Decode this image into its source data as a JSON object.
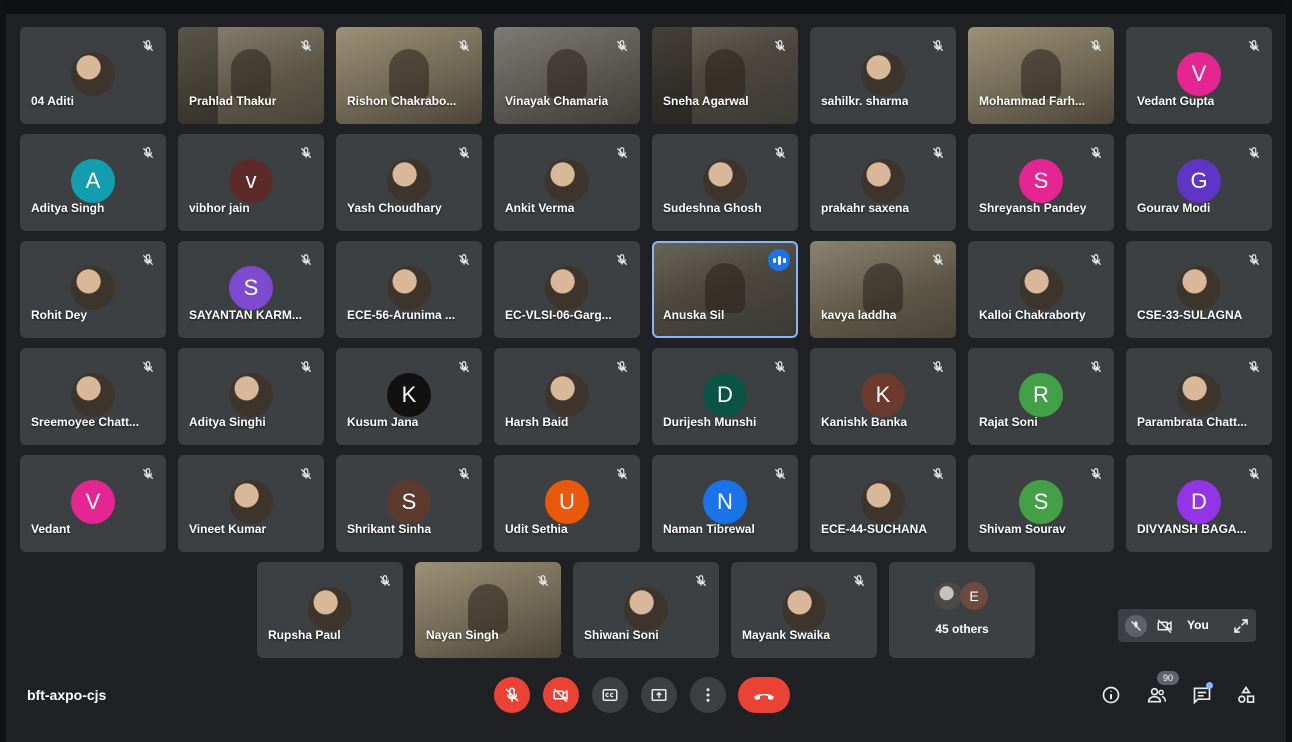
{
  "meeting": {
    "code": "bft-axpo-cjs"
  },
  "participants": [
    {
      "name": "04 Aditi",
      "type": "photo"
    },
    {
      "name": "Prahlad Thakur",
      "type": "video"
    },
    {
      "name": "Rishon Chakrabo...",
      "type": "video"
    },
    {
      "name": "Vinayak Chamaria",
      "type": "video"
    },
    {
      "name": "Sneha Agarwal",
      "type": "video"
    },
    {
      "name": "sahilkr. sharma",
      "type": "photo"
    },
    {
      "name": "Mohammad Farh...",
      "type": "video"
    },
    {
      "name": "Vedant Gupta",
      "type": "letter",
      "initial": "V",
      "color": "#e52592"
    },
    {
      "name": "Aditya Singh",
      "type": "letter",
      "initial": "A",
      "color": "#129eaf"
    },
    {
      "name": "vibhor jain",
      "type": "letter",
      "initial": "v",
      "color": "#5c2b29"
    },
    {
      "name": "Yash Choudhary",
      "type": "photo"
    },
    {
      "name": "Ankit Verma",
      "type": "photo"
    },
    {
      "name": "Sudeshna Ghosh",
      "type": "photo"
    },
    {
      "name": "prakahr saxena",
      "type": "photo"
    },
    {
      "name": "Shreyansh Pandey",
      "type": "letter",
      "initial": "S",
      "color": "#e52592"
    },
    {
      "name": "Gourav Modi",
      "type": "letter",
      "initial": "G",
      "color": "#5f35c5"
    },
    {
      "name": "Rohit Dey",
      "type": "photo"
    },
    {
      "name": "SAYANTAN KARM...",
      "type": "letter",
      "initial": "S",
      "color": "#7e4ad0"
    },
    {
      "name": "ECE-56-Arunima ...",
      "type": "photo"
    },
    {
      "name": "EC-VLSI-06-Garg...",
      "type": "photo"
    },
    {
      "name": "Anuska Sil",
      "type": "video",
      "active": true
    },
    {
      "name": "kavya laddha",
      "type": "video"
    },
    {
      "name": "Kalloi Chakraborty",
      "type": "photo"
    },
    {
      "name": "CSE-33-SULAGNA",
      "type": "photo"
    },
    {
      "name": "Sreemoyee Chatt...",
      "type": "photo"
    },
    {
      "name": "Aditya Singhi",
      "type": "photo"
    },
    {
      "name": "Kusum Jana",
      "type": "letter",
      "initial": "K",
      "color": "#111111"
    },
    {
      "name": "Harsh Baid",
      "type": "photo"
    },
    {
      "name": "Durijesh Munshi",
      "type": "letter",
      "initial": "D",
      "color": "#0b5345"
    },
    {
      "name": "Kanishk Banka",
      "type": "letter",
      "initial": "K",
      "color": "#6d3a2e"
    },
    {
      "name": "Rajat Soni",
      "type": "letter",
      "initial": "R",
      "color": "#43a047"
    },
    {
      "name": "Parambrata Chatt...",
      "type": "photo"
    },
    {
      "name": "Vedant",
      "type": "letter",
      "initial": "V",
      "color": "#e52592"
    },
    {
      "name": "Vineet Kumar",
      "type": "photo"
    },
    {
      "name": "Shrikant Sinha",
      "type": "letter",
      "initial": "S",
      "color": "#5c3a2e"
    },
    {
      "name": "Udit Sethia",
      "type": "letter",
      "initial": "U",
      "color": "#e8590c"
    },
    {
      "name": "Naman Tibrewal",
      "type": "letter",
      "initial": "N",
      "color": "#1a73e8"
    },
    {
      "name": "ECE-44-SUCHANA",
      "type": "photo"
    },
    {
      "name": "Shivam Sourav",
      "type": "letter",
      "initial": "S",
      "color": "#43a047"
    },
    {
      "name": "DIVYANSH BAGA...",
      "type": "letter",
      "initial": "D",
      "color": "#9334e6"
    }
  ],
  "bottom_row": [
    {
      "name": "Rupsha Paul",
      "type": "photo"
    },
    {
      "name": "Nayan Singh",
      "type": "video"
    },
    {
      "name": "Shiwani Soni",
      "type": "photo"
    },
    {
      "name": "Mayank Swaika",
      "type": "photo"
    }
  ],
  "others": {
    "label": "45 others",
    "initial": "E",
    "color": "#6e4b3f"
  },
  "self_view": {
    "label": "You"
  },
  "participant_count": "90",
  "colors": {
    "bg": "#202124",
    "tile": "#3c4043",
    "red": "#ea4335",
    "accent": "#8ab4f8"
  }
}
